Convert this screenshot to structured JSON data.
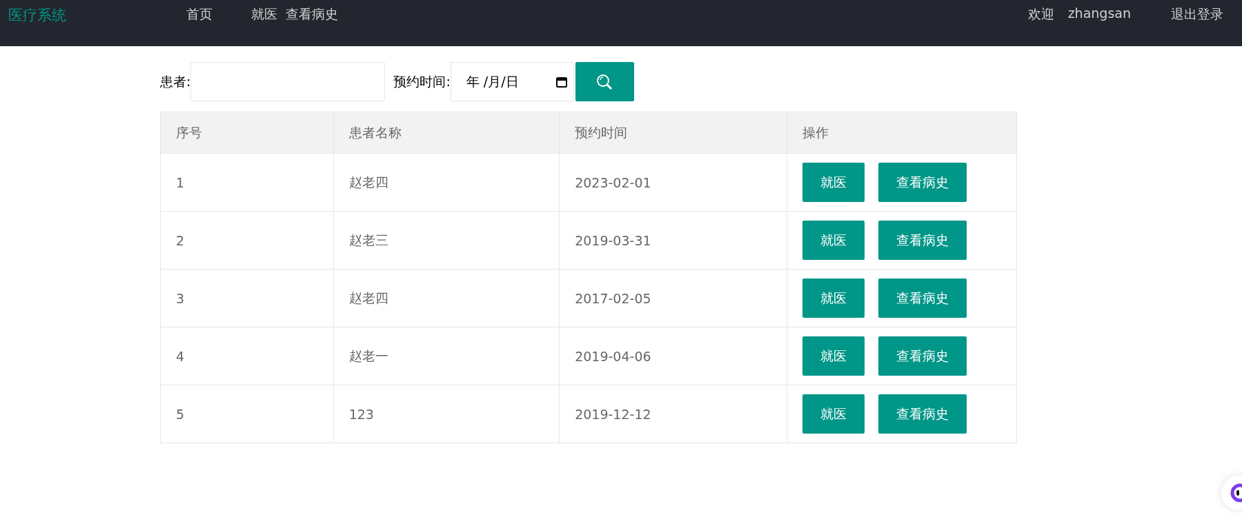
{
  "header": {
    "logo": "医疗系统",
    "nav": [
      {
        "label": "首页"
      },
      {
        "label": "就医"
      },
      {
        "label": "查看病史"
      }
    ],
    "welcome": "欢迎",
    "username": "zhangsan",
    "logout": "退出登录"
  },
  "search": {
    "patient_label": "患者:",
    "date_label": "预约时间:",
    "date_placeholder": "年 /月/日"
  },
  "table": {
    "columns": [
      "序号",
      "患者名称",
      "预约时间",
      "操作"
    ],
    "rows": [
      {
        "index": "1",
        "name": "赵老四",
        "time": "2023-02-01",
        "actions": [
          "就医",
          "查看病史"
        ]
      },
      {
        "index": "2",
        "name": "赵老三",
        "time": "2019-03-31",
        "actions": [
          "就医",
          "查看病史"
        ]
      },
      {
        "index": "3",
        "name": "赵老四",
        "time": "2017-02-05",
        "actions": [
          "就医",
          "查看病史"
        ]
      },
      {
        "index": "4",
        "name": "赵老一",
        "time": "2019-04-06",
        "actions": [
          "就医",
          "查看病史"
        ]
      },
      {
        "index": "5",
        "name": "123",
        "time": "2019-12-12",
        "actions": [
          "就医",
          "查看病史"
        ]
      }
    ]
  }
}
